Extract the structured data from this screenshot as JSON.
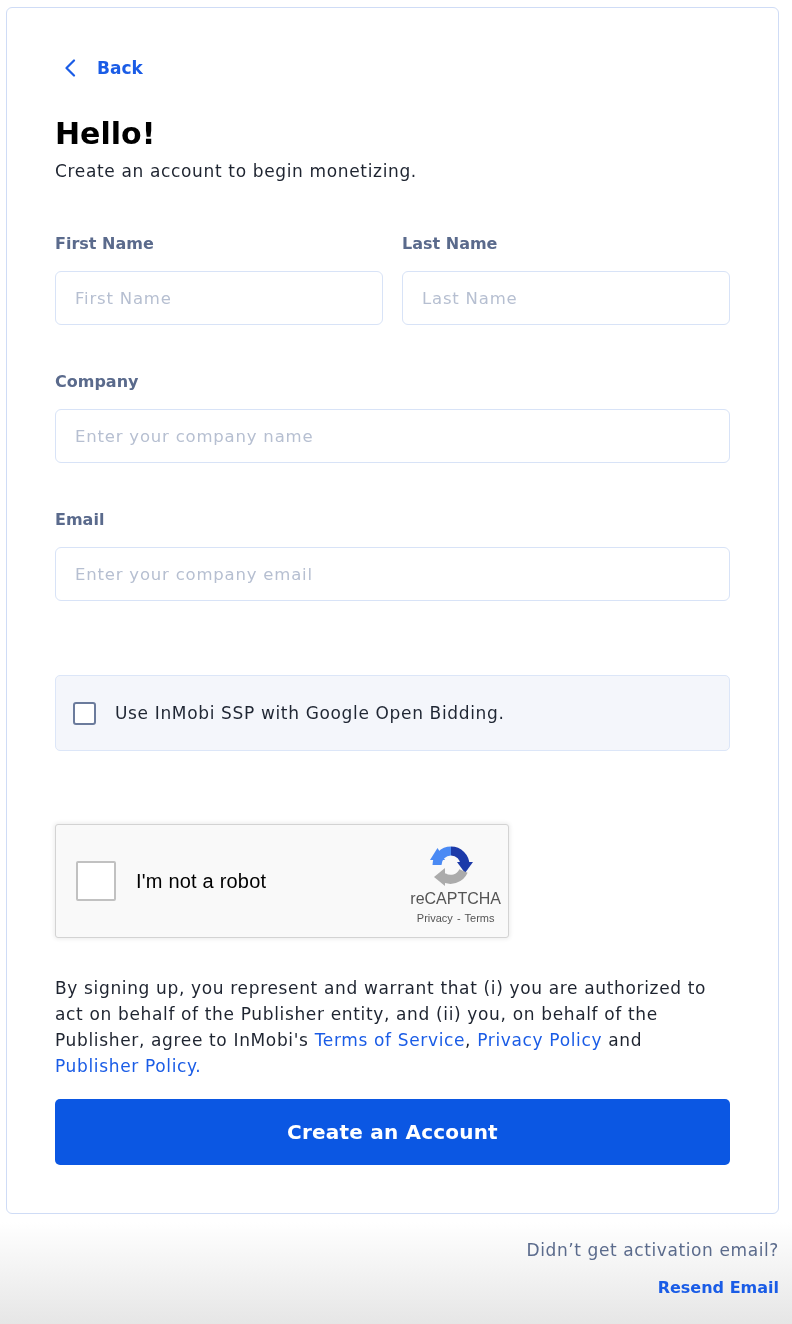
{
  "back_link": {
    "label": "Back"
  },
  "heading": "Hello!",
  "subtitle": "Create an account to begin monetizing.",
  "field_rows": [
    {
      "fields": [
        {
          "label": "First Name",
          "placeholder": "First Name"
        },
        {
          "label": "Last Name",
          "placeholder": "Last Name"
        }
      ]
    },
    {
      "fields": [
        {
          "label": "Company",
          "placeholder": "Enter your company name"
        }
      ]
    },
    {
      "fields": [
        {
          "label": "Email",
          "placeholder": "Enter your company email"
        }
      ]
    }
  ],
  "option_checkbox": {
    "label": "Use InMobi SSP with Google Open Bidding.",
    "checked": false
  },
  "captcha": {
    "label": "I'm not a robot",
    "checked": false,
    "brand": "reCAPTCHA",
    "links": [
      {
        "label": "Privacy"
      },
      {
        "label": "Terms"
      }
    ],
    "separator": "-"
  },
  "terms": [
    {
      "kind": "text",
      "text": "By signing up, you represent and warrant that (i) you are authorized to act on behalf of the Publisher entity, and (ii) you, on behalf of the Publisher, agree to InMobi's "
    },
    {
      "kind": "link",
      "text": "Terms of Service"
    },
    {
      "kind": "text",
      "text": ", "
    },
    {
      "kind": "link",
      "text": "Privacy Policy"
    },
    {
      "kind": "text",
      "text": " and "
    },
    {
      "kind": "link",
      "text": "Publisher Policy."
    }
  ],
  "submit_button": {
    "label": "Create an Account"
  },
  "footer": {
    "prompt": "Didn’t get activation email?",
    "link": "Resend Email"
  }
}
